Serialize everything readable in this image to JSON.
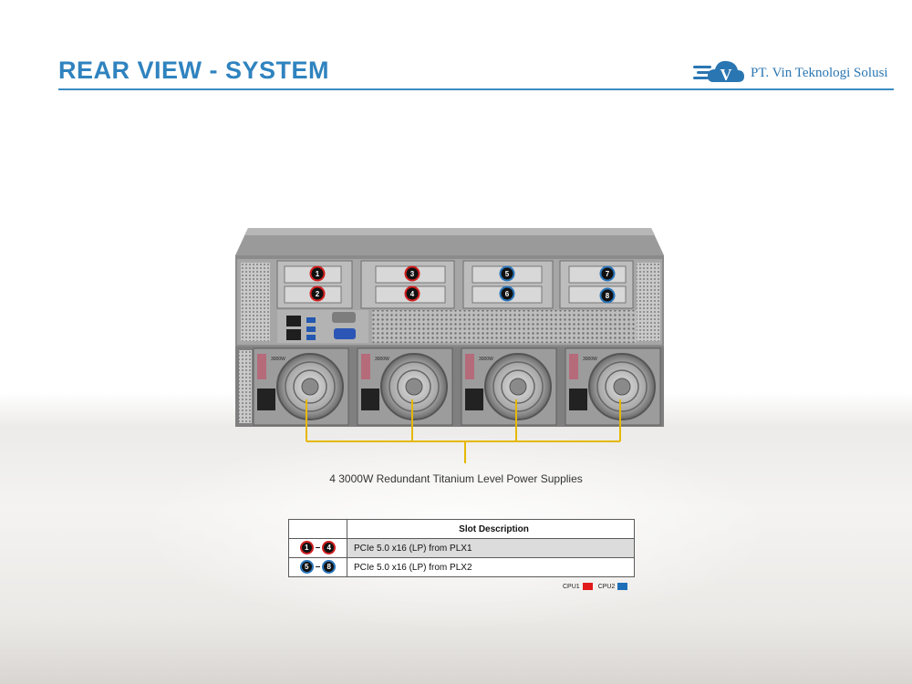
{
  "header": {
    "title": "REAR VIEW - SYSTEM",
    "brand_name": "PT. Vin Teknologi Solusi",
    "logo_letter": "V"
  },
  "chassis": {
    "slot_labels": [
      "1",
      "2",
      "3",
      "4",
      "5",
      "6",
      "7",
      "8"
    ],
    "psu_label": "3000W",
    "psu_caption": "4 3000W Redundant Titanium Level Power Supplies"
  },
  "slot_table": {
    "header": "Slot Description",
    "rows": [
      {
        "range_start": "1",
        "range_end": "4",
        "description": "PCIe 5.0 x16 (LP) from PLX1",
        "cpu": "CPU1"
      },
      {
        "range_start": "5",
        "range_end": "8",
        "description": "PCIe 5.0 x16 (LP) from PLX2",
        "cpu": "CPU2"
      }
    ]
  },
  "legend": {
    "items": [
      {
        "label": "CPU1",
        "color": "#e11b1b"
      },
      {
        "label": "CPU2",
        "color": "#1f6fb8"
      }
    ]
  },
  "colors": {
    "accent": "#2f83bf",
    "cpu1": "#e11b1b",
    "cpu2": "#1f6fb8",
    "psu_bracket": "#e6b800"
  }
}
